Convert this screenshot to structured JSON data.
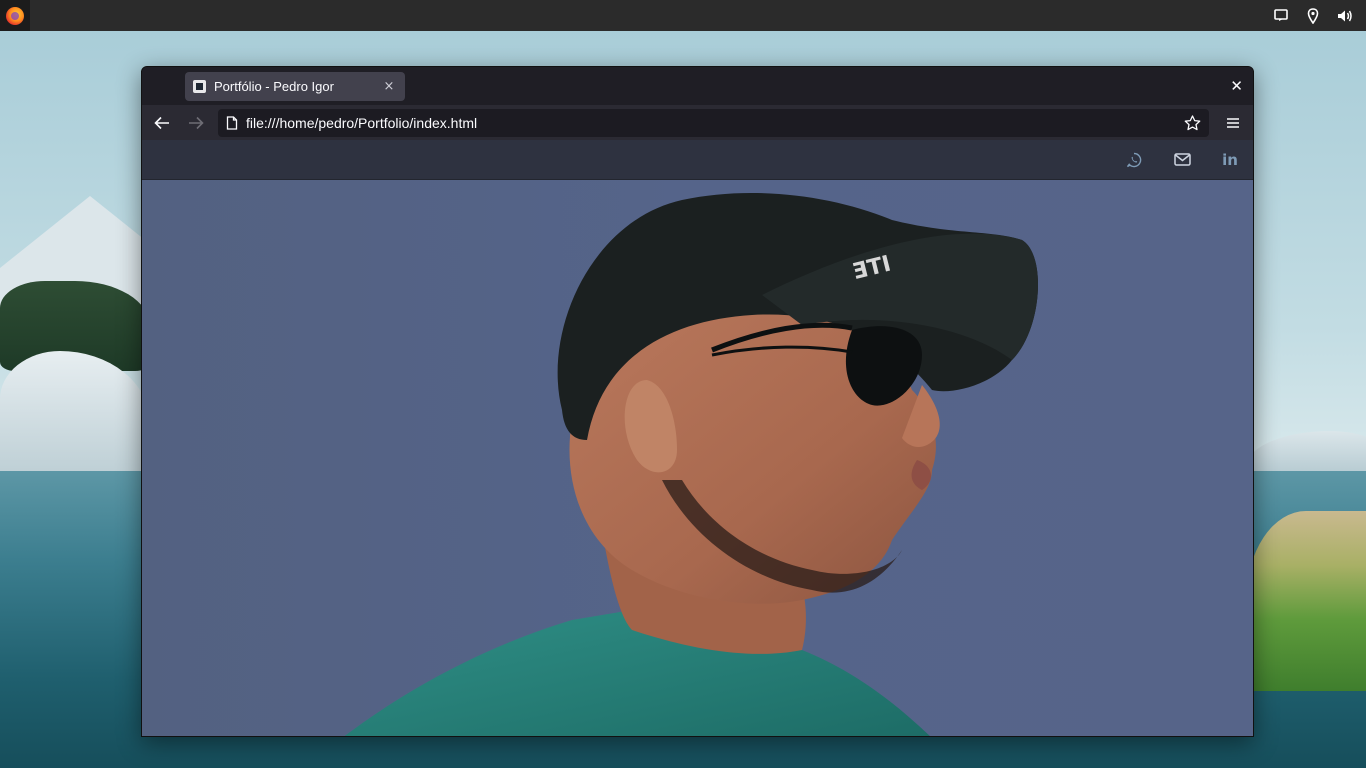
{
  "desktop": {
    "panel": {
      "launcher_icon": "firefox-icon",
      "tray_icons": [
        "screen-icon",
        "location-icon",
        "volume-icon"
      ]
    }
  },
  "browser": {
    "tab": {
      "title": "Portfólio - Pedro Igor",
      "close_label": "×"
    },
    "window_close_label": "✕",
    "url": "file:///home/pedro/Portfolio/index.html",
    "nav_icons": [
      "back-arrow-icon",
      "forward-arrow-icon",
      "page-icon",
      "bookmark-star-icon",
      "hamburger-menu-icon"
    ]
  },
  "page": {
    "header": {
      "social_links": [
        "whatsapp-icon",
        "mail-icon",
        "linkedin-icon"
      ],
      "linkedin_text": "in"
    },
    "hero": {
      "background_color": "#536384",
      "header_color": "#2e3240",
      "icon_color": "#7e9bb6"
    }
  }
}
